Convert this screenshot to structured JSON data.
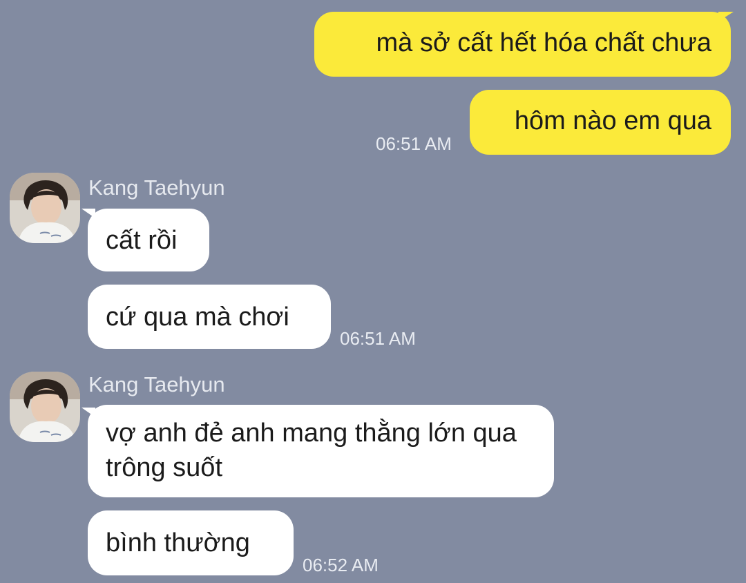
{
  "messages": {
    "outgoing": [
      {
        "text": "mà sở cất hết hóa chất chưa"
      },
      {
        "text": "hôm nào em qua",
        "time": "06:51 AM"
      }
    ],
    "group1": {
      "sender": "Kang Taehyun",
      "avatar_icon": "profile-photo-icon",
      "messages": [
        {
          "text": "cất rồi"
        },
        {
          "text": "cứ qua mà chơi",
          "time": "06:51 AM"
        }
      ]
    },
    "group2": {
      "sender": "Kang Taehyun",
      "avatar_icon": "profile-photo-icon",
      "messages": [
        {
          "text": "vợ anh đẻ anh mang thằng lớn qua trông suốt"
        },
        {
          "text": "bình thường",
          "time": "06:52 AM"
        }
      ]
    }
  },
  "colors": {
    "background": "#828ba1",
    "outgoing_bubble": "#fbea3a",
    "incoming_bubble": "#ffffff"
  }
}
